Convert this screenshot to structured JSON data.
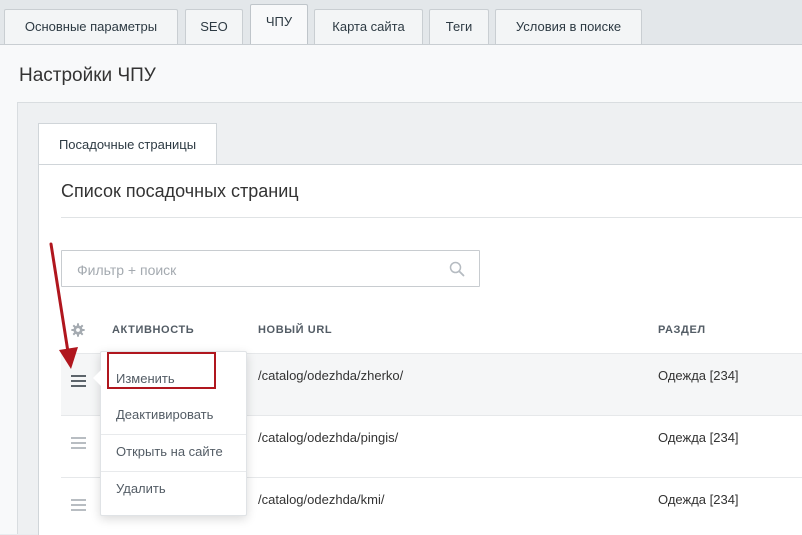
{
  "top_tabs": [
    {
      "label": "Основные параметры",
      "active": false
    },
    {
      "label": "SEO",
      "active": false
    },
    {
      "label": "ЧПУ",
      "active": true
    },
    {
      "label": "Карта сайта",
      "active": false
    },
    {
      "label": "Теги",
      "active": false
    },
    {
      "label": "Условия в поиске",
      "active": false
    }
  ],
  "panel": {
    "title": "Настройки ЧПУ",
    "sub_tab": "Посадочные страницы",
    "list_title": "Список посадочных страниц"
  },
  "filter": {
    "placeholder": "Фильтр + поиск",
    "value": ""
  },
  "table": {
    "headers": [
      "АКТИВНОСТЬ",
      "НОВЫЙ URL",
      "РАЗДЕЛ"
    ],
    "rows": [
      {
        "url": "/catalog/odezhda/zherko/",
        "section": "Одежда [234]"
      },
      {
        "url": "/catalog/odezhda/pingis/",
        "section": "Одежда [234]"
      },
      {
        "url": "/catalog/odezhda/kmi/",
        "section": "Одежда [234]"
      }
    ]
  },
  "context_menu": {
    "items": [
      "Изменить",
      "Деактивировать",
      "Открыть на сайте",
      "Удалить"
    ]
  },
  "colors": {
    "annotation": "#b0161e",
    "accent_text": "#535c65"
  },
  "icons": [
    "search-icon",
    "gear-icon",
    "hamburger-menu-icon",
    "annotation-arrow"
  ]
}
